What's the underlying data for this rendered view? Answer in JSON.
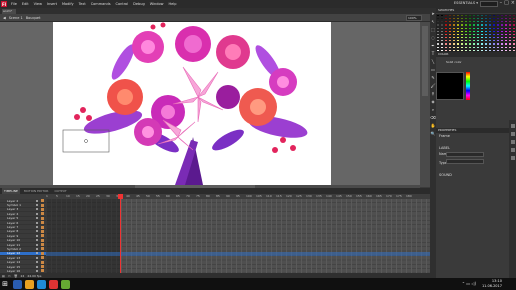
{
  "app": {
    "logo": "Fl",
    "menu": [
      "File",
      "Edit",
      "View",
      "Insert",
      "Modify",
      "Text",
      "Commands",
      "Control",
      "Debug",
      "Window",
      "Help"
    ],
    "workspace": "ESSENTIALS ▾"
  },
  "document": {
    "tab": "anim*",
    "scene": "Scene 1",
    "symbol": "Bouquet",
    "zoom": "100%"
  },
  "timeline": {
    "tabs": [
      "TIMELINE",
      "MOTION EDITOR",
      "OUTPUT"
    ],
    "active_tab": "TIMELINE",
    "ruler": [
      "1",
      "5",
      "10",
      "15",
      "20",
      "25",
      "30",
      "35",
      "40",
      "45",
      "50",
      "55",
      "60",
      "65",
      "70",
      "75",
      "80",
      "85",
      "90",
      "95",
      "100",
      "105",
      "110",
      "115",
      "120",
      "125",
      "130",
      "135",
      "140",
      "145",
      "150",
      "155",
      "160",
      "165",
      "170",
      "175",
      "180"
    ],
    "layers": [
      {
        "name": "Layer 2"
      },
      {
        "name": "Symbol 1"
      },
      {
        "name": "Layer 3"
      },
      {
        "name": "Layer 4"
      },
      {
        "name": "Layer 5"
      },
      {
        "name": "Layer 6"
      },
      {
        "name": "Layer 7"
      },
      {
        "name": "Layer 8"
      },
      {
        "name": "Layer 9"
      },
      {
        "name": "Layer 10"
      },
      {
        "name": "Layer 11"
      },
      {
        "name": "Symbol 2"
      },
      {
        "name": "Layer 12"
      },
      {
        "name": "Layer 13"
      },
      {
        "name": "Layer 14"
      },
      {
        "name": "Layer 15"
      },
      {
        "name": "Layer 16"
      },
      {
        "name": "Layer 17"
      }
    ],
    "selected_layer_index": 12,
    "current_frame": "24",
    "fps": "24.00 fps"
  },
  "panels": {
    "swatches_title": "SWATCHES",
    "color_title": "COLOR",
    "color_type": "Solid color",
    "properties_title": "PROPERTIES",
    "properties_label": "Frame",
    "label_section": "LABEL",
    "name_label": "Name:",
    "type_label": "Type:",
    "sound_section": "SOUND"
  },
  "taskbar": {
    "time": "13:10",
    "date": "11.06.2017"
  },
  "colors": {
    "accent": "#2e6fc9",
    "playhead": "#e33333"
  }
}
